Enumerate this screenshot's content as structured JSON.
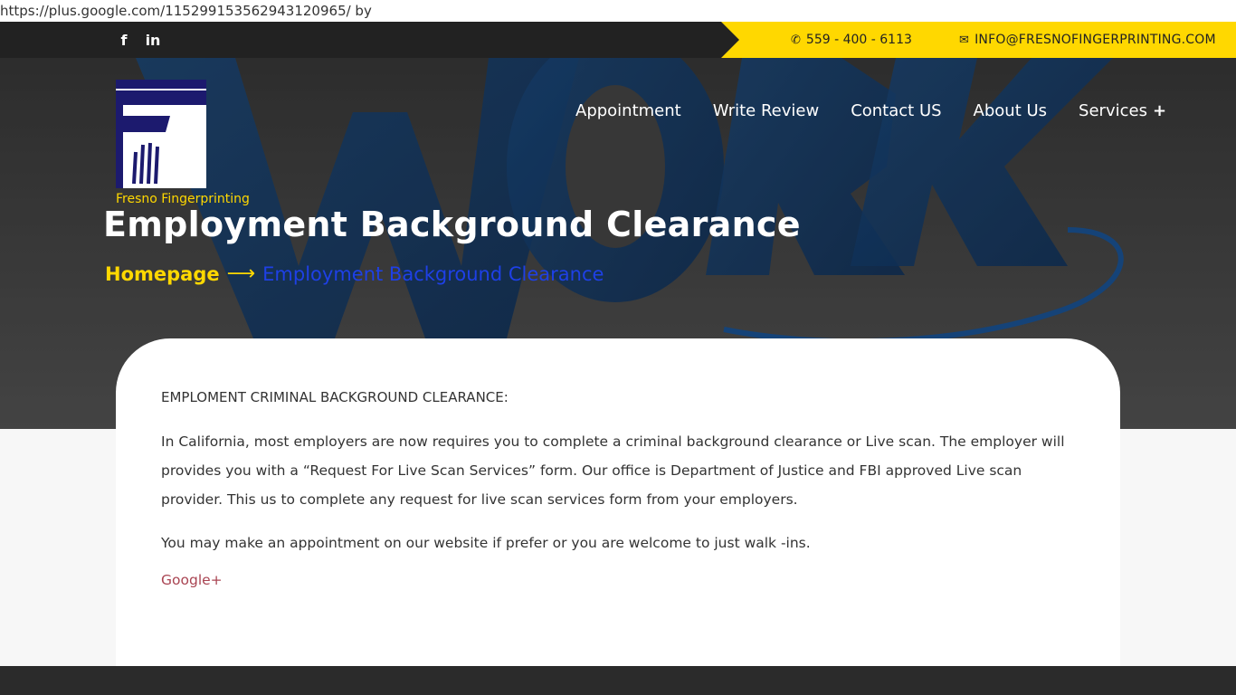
{
  "url_bar": {
    "text": "https://plus.google.com/115299153562943120965/ by"
  },
  "topbar": {
    "social": [
      {
        "name": "facebook-icon",
        "glyph": "f"
      },
      {
        "name": "linkedin-icon",
        "glyph": "in"
      }
    ],
    "phone": "559 - 400 - 6113",
    "email": "INFO@FRESNOFINGERPRINTING.COM",
    "accent_color": "#ffd800"
  },
  "logo": {
    "caption": "Fresno Fingerprinting",
    "inner_text": "Fresno Fingerprinting"
  },
  "nav": {
    "items": [
      "Appointment",
      "Write Review",
      "Contact US",
      "About Us",
      "Services"
    ],
    "services_plus": "+"
  },
  "hero": {
    "title": "Employment Background Clearance",
    "breadcrumb_home": "Homepage",
    "breadcrumb_arrow": "⟶",
    "breadcrumb_current": "Employment Background Clearance"
  },
  "content": {
    "heading": "EMPLOMENT CRIMINAL BACKGROUND CLEARANCE:",
    "para1": "In California, most employers are now requires you to complete a criminal background clearance or Live scan. The employer will provides you with a “Request For Live Scan Services” form. Our office is Department of Justice and FBI approved Live scan provider. This us to complete any request for live scan services form from your employers.",
    "para2": "You may make an appointment on our website if prefer or you are welcome to just walk -ins.",
    "link": "Google+"
  }
}
